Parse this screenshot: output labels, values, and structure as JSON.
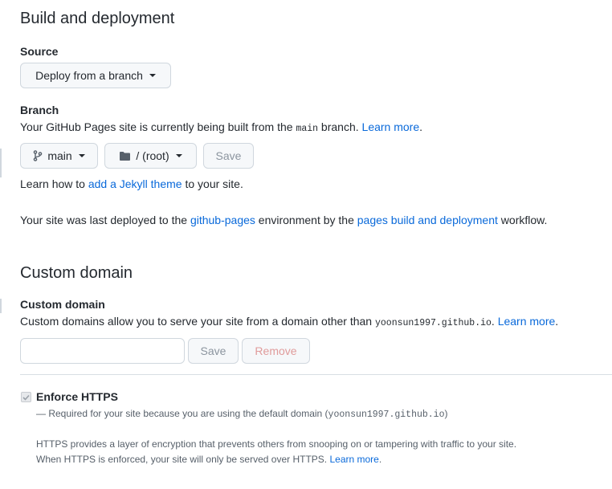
{
  "build": {
    "title": "Build and deployment",
    "source_label": "Source",
    "source_select": "Deploy from a branch",
    "branch_label": "Branch",
    "branch_desc_pre": "Your GitHub Pages site is currently being built from the ",
    "branch_desc_code": "main",
    "branch_desc_post": " branch. ",
    "branch_desc_link": "Learn more",
    "branch_desc_end": ".",
    "branch_select": "main",
    "folder_select": "/ (root)",
    "save_label": "Save",
    "jekyll_pre": "Learn how to ",
    "jekyll_link": "add a Jekyll theme",
    "jekyll_post": " to your site.",
    "deploy_pre": "Your site was last deployed to the ",
    "deploy_env_link": "github-pages",
    "deploy_mid": " environment by the ",
    "deploy_workflow_link": "pages build and deployment",
    "deploy_post": " workflow."
  },
  "custom_domain": {
    "title": "Custom domain",
    "label": "Custom domain",
    "desc_pre": "Custom domains allow you to serve your site from a domain other than ",
    "desc_code": "yoonsun1997.github.io",
    "desc_post": ". ",
    "desc_link": "Learn more",
    "desc_end": ".",
    "input_value": "",
    "save_label": "Save",
    "remove_label": "Remove"
  },
  "https": {
    "label": "Enforce HTTPS",
    "checked": true,
    "note_pre": "— Required for your site because you are using the default domain (",
    "note_code": "yoonsun1997.github.io",
    "note_post": ")",
    "info_line1": "HTTPS provides a layer of encryption that prevents others from snooping on or tampering with traffic to your site.",
    "info_line2_pre": "When HTTPS is enforced, your site will only be served over HTTPS. ",
    "info_line2_link": "Learn more",
    "info_line2_end": "."
  },
  "colors": {
    "link": "#0969da",
    "text": "#24292f",
    "muted": "#57606a",
    "button_bg": "#f6f8fa",
    "border": "#d0d7de",
    "danger_disabled": "#e09b9b"
  },
  "icons": {
    "branch": "git-branch-icon",
    "folder": "folder-icon",
    "caret": "caret-down-icon",
    "check": "check-icon"
  }
}
